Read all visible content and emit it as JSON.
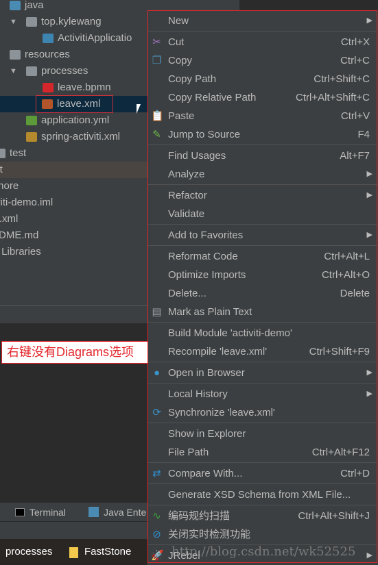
{
  "tree": [
    {
      "label": "java",
      "indent": 14,
      "icon": "folder-icon",
      "color": "#4a8bb3"
    },
    {
      "label": "top.kylewang",
      "indent": 38,
      "icon": "package-icon",
      "color": "#8c9399",
      "expanded": true
    },
    {
      "label": "ActivitiApplicatio",
      "indent": 62,
      "icon": "spring-boot-class-icon",
      "color": "#3d85b0"
    },
    {
      "label": "resources",
      "indent": 14,
      "icon": "resources-folder-icon",
      "color": "#8c9399"
    },
    {
      "label": "processes",
      "indent": 38,
      "icon": "package-icon",
      "color": "#8c9399",
      "expanded": true
    },
    {
      "label": "leave.bpmn",
      "indent": 62,
      "icon": "bpmn-file-icon",
      "color": "#d4262b"
    },
    {
      "label": "leave.xml",
      "indent": 62,
      "icon": "xml-file-icon",
      "color": "#b3552a",
      "selected": true
    },
    {
      "label": "application.yml",
      "indent": 38,
      "icon": "spring-yml-icon",
      "color": "#5c9a3a"
    },
    {
      "label": "spring-activiti.xml",
      "indent": 38,
      "icon": "spring-xml-icon",
      "color": "#b58a2e"
    },
    {
      "label": "test",
      "indent": -8,
      "icon": "folder-icon",
      "color": "#8c9399"
    },
    {
      "label": "rget",
      "indent": -22,
      "highlight": true
    },
    {
      "label": "itignore",
      "indent": -22
    },
    {
      "label": "ctiviti-demo.iml",
      "indent": -22
    },
    {
      "label": "om.xml",
      "indent": -22
    },
    {
      "label": "EADME.md",
      "indent": -22
    },
    {
      "label": "nal Libraries",
      "indent": -22
    }
  ],
  "annotation": "右键没有Diagrams选项",
  "toolbar": {
    "terminal": "Terminal",
    "java_ent": "Java Ente"
  },
  "taskbar": {
    "processes": "processes",
    "faststone": "FastStone"
  },
  "watermark": "http://blog.csdn.net/wk52525",
  "menu": [
    [
      {
        "label": "New",
        "submenu": true
      }
    ],
    [
      {
        "label": "Cut",
        "shortcut": "Ctrl+X",
        "icon": "scissors-icon",
        "glyph": "✂",
        "color": "#a77bc9"
      },
      {
        "label": "Copy",
        "shortcut": "Ctrl+C",
        "icon": "copy-icon",
        "glyph": "❐",
        "color": "#4a8bb3"
      },
      {
        "label": "Copy Path",
        "shortcut": "Ctrl+Shift+C"
      },
      {
        "label": "Copy Relative Path",
        "shortcut": "Ctrl+Alt+Shift+C"
      },
      {
        "label": "Paste",
        "shortcut": "Ctrl+V",
        "icon": "paste-icon",
        "glyph": "📋",
        "color": "#c9963e"
      },
      {
        "label": "Jump to Source",
        "shortcut": "F4",
        "icon": "edit-source-icon",
        "glyph": "✎",
        "color": "#6cb34a"
      }
    ],
    [
      {
        "label": "Find Usages",
        "shortcut": "Alt+F7"
      },
      {
        "label": "Analyze",
        "submenu": true
      }
    ],
    [
      {
        "label": "Refactor",
        "submenu": true
      },
      {
        "label": "Validate"
      }
    ],
    [
      {
        "label": "Add to Favorites",
        "submenu": true
      }
    ],
    [
      {
        "label": "Reformat Code",
        "shortcut": "Ctrl+Alt+L"
      },
      {
        "label": "Optimize Imports",
        "shortcut": "Ctrl+Alt+O"
      },
      {
        "label": "Delete...",
        "shortcut": "Delete"
      },
      {
        "label": "Mark as Plain Text",
        "icon": "plain-text-icon",
        "glyph": "▤",
        "color": "#9aa0a5"
      }
    ],
    [
      {
        "label": "Build Module 'activiti-demo'"
      },
      {
        "label": "Recompile 'leave.xml'",
        "shortcut": "Ctrl+Shift+F9"
      }
    ],
    [
      {
        "label": "Open in Browser",
        "submenu": true,
        "icon": "globe-icon",
        "glyph": "●",
        "color": "#3a93c9"
      }
    ],
    [
      {
        "label": "Local History",
        "submenu": true
      },
      {
        "label": "Synchronize 'leave.xml'",
        "icon": "sync-icon",
        "glyph": "⟳",
        "color": "#3a93c9"
      }
    ],
    [
      {
        "label": "Show in Explorer"
      },
      {
        "label": "File Path",
        "shortcut": "Ctrl+Alt+F12"
      }
    ],
    [
      {
        "label": "Compare With...",
        "shortcut": "Ctrl+D",
        "icon": "compare-icon",
        "glyph": "⇄",
        "color": "#2e8fd1"
      }
    ],
    [
      {
        "label": "Generate XSD Schema from XML File..."
      }
    ],
    [
      {
        "label": "编码规约扫描",
        "shortcut": "Ctrl+Alt+Shift+J",
        "icon": "code-scan-icon",
        "glyph": "∿",
        "color": "#3aa53a"
      },
      {
        "label": "关闭实时检测功能",
        "icon": "disable-icon",
        "glyph": "⊘",
        "color": "#2e8fd1"
      }
    ],
    [
      {
        "label": "JRebel",
        "submenu": true,
        "icon": "jrebel-icon",
        "glyph": "🚀",
        "color": "#7cb342"
      }
    ]
  ],
  "colors": {
    "menu_bg": "#3c3f41",
    "selection": "#0d293e",
    "annotation_red": "#e3262b",
    "text": "#bbbbbb"
  }
}
